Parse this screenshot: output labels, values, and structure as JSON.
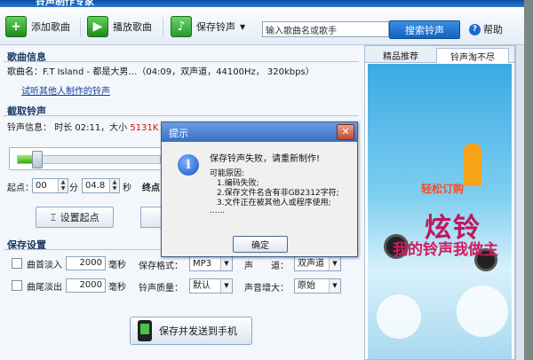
{
  "window": {
    "title": "铃声制作专家"
  },
  "toolbar": {
    "add_song": "添加歌曲",
    "play_song": "播放歌曲",
    "save_ringtone": "保存铃声",
    "search_placeholder": "输入歌曲名或歌手",
    "search_button": "搜索铃声",
    "help": "帮助"
  },
  "song_info": {
    "section_title": "歌曲信息",
    "name_label": "歌曲名：",
    "name_value": "F.T Island - 都是大男…（04:09，双声道，44100Hz，  320kbps）",
    "other_link": "试听其他人制作的铃声"
  },
  "cut": {
    "section_title": "截取铃声",
    "info_label": "铃声信息：",
    "info_value": "时长 02:11，大小",
    "size_value": "5131K",
    "progress": 0.11,
    "start_label": "起点：",
    "start_min": "00",
    "min_unit": "分",
    "start_sec": "04.8",
    "sec_unit": "秒",
    "end_label": "终点",
    "set_start_button": "设置起点"
  },
  "save_settings": {
    "section_title": "保存设置",
    "fade_in_label": "曲首淡入",
    "fade_in_ms": "2000",
    "fade_out_label": "曲尾淡出",
    "fade_out_ms": "2000",
    "ms_unit": "毫秒",
    "format_label": "保存格式：",
    "format_value": "MP3",
    "channel_label": "声　　道：",
    "channel_value": "双声道",
    "quality_label": "铃声质量：",
    "quality_value": "默认",
    "boost_label": "声音增大：",
    "boost_value": "原始",
    "send_button": "保存并发送到手机"
  },
  "right_panel": {
    "tabs": [
      "精品推荐",
      "铃声淘不尽"
    ],
    "banner_top": "轻松订购",
    "banner_big": "炫铃",
    "banner_bottom": "我的铃声我做主"
  },
  "dialog": {
    "title": "提示",
    "message": "保存铃声失败，请重新制作!",
    "reasons_title": "可能原因:",
    "reason1": "1.编码失败;",
    "reason2": "2.保存文件名含有非GB2312字符;",
    "reason3": "3.文件正在被其他人或程序使用;",
    "ellipsis": "......",
    "ok_button": "确定"
  },
  "colors": {
    "accent": "#1462c0",
    "warning": "#d01010"
  }
}
